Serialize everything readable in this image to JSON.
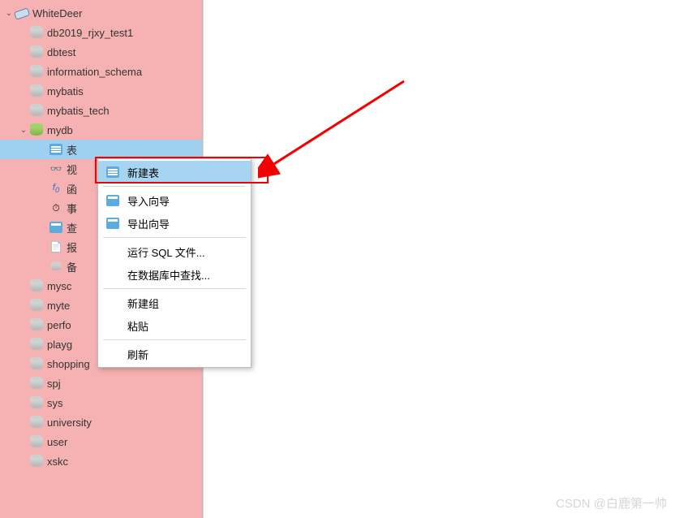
{
  "connection": {
    "name": "WhiteDeer"
  },
  "databases": [
    {
      "name": "db2019_rjxy_test1",
      "open": false
    },
    {
      "name": "dbtest",
      "open": false
    },
    {
      "name": "information_schema",
      "open": false
    },
    {
      "name": "mybatis",
      "open": false
    },
    {
      "name": "mybatis_tech",
      "open": false
    },
    {
      "name": "mydb",
      "open": true,
      "children": [
        {
          "label": "表",
          "icon": "tables",
          "selected": true
        },
        {
          "label": "视",
          "icon": "views"
        },
        {
          "label": "函",
          "icon": "functions"
        },
        {
          "label": "事",
          "icon": "events"
        },
        {
          "label": "查",
          "icon": "queries"
        },
        {
          "label": "报",
          "icon": "reports"
        },
        {
          "label": "备",
          "icon": "backups"
        }
      ]
    },
    {
      "name": "mysc",
      "open": false
    },
    {
      "name": "myte",
      "open": false
    },
    {
      "name": "perfo",
      "open": false
    },
    {
      "name": "playg",
      "open": false
    },
    {
      "name": "shopping",
      "open": false
    },
    {
      "name": "spj",
      "open": false
    },
    {
      "name": "sys",
      "open": false
    },
    {
      "name": "university",
      "open": false
    },
    {
      "name": "user",
      "open": false
    },
    {
      "name": "xskc",
      "open": false
    }
  ],
  "contextMenu": {
    "items": [
      {
        "label": "新建表",
        "icon": "new-table",
        "highlighted": true
      },
      {
        "separator": true
      },
      {
        "label": "导入向导",
        "icon": "import"
      },
      {
        "label": "导出向导",
        "icon": "export"
      },
      {
        "separator": true
      },
      {
        "label": "运行 SQL 文件..."
      },
      {
        "label": "在数据库中查找..."
      },
      {
        "separator": true
      },
      {
        "label": "新建组"
      },
      {
        "label": "粘贴"
      },
      {
        "separator": true
      },
      {
        "label": "刷新"
      }
    ]
  },
  "watermark": "CSDN @白鹿第一帅"
}
